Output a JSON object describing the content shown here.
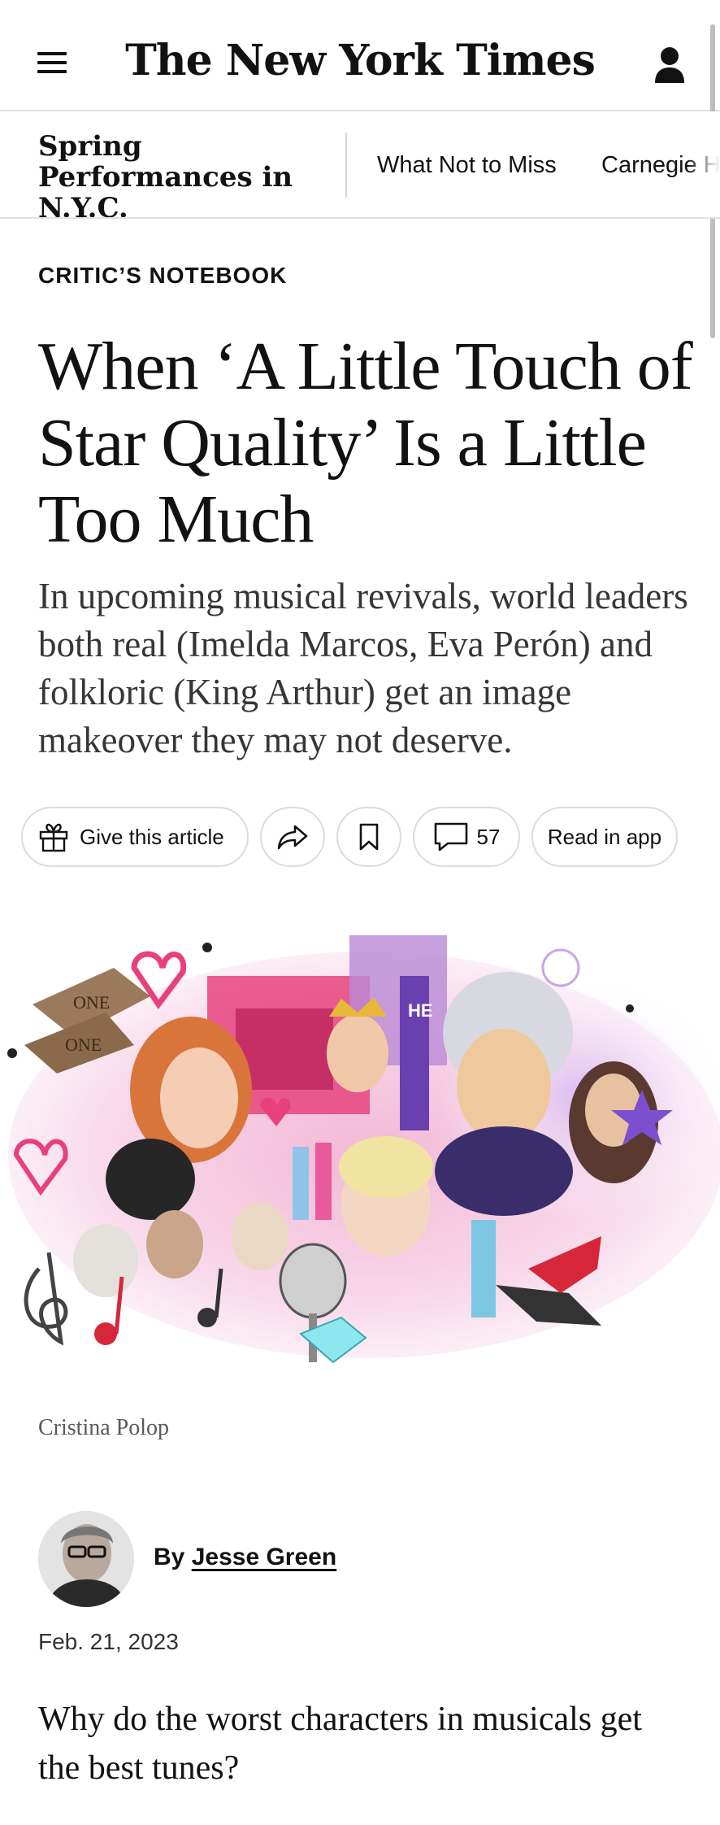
{
  "header": {
    "masthead": "The New York Times",
    "menu_icon": "hamburger-menu-icon",
    "account_icon": "user-account-icon"
  },
  "subnav": {
    "section_title": "Spring Performances in N.Y.C.",
    "links": [
      "What Not to Miss",
      "Carnegie H"
    ]
  },
  "article": {
    "kicker": "CRITIC’S NOTEBOOK",
    "headline": "When ‘A Little Touch of Star Quality’ Is a Little Too Much",
    "summary": "In upcoming musical revivals, world leaders both real (Imelda Marcos, Eva Perón) and folkloric (King Arthur) get an image makeover they may not deserve.",
    "caption": "Cristina Polop",
    "byline_prefix": "By",
    "author": "Jesse Green",
    "date": "Feb. 21, 2023",
    "lede": "Why do the worst characters in musicals get the best tunes?"
  },
  "actions": {
    "gift_label": "Give this article",
    "comments_count": "57",
    "read_in_app_label": "Read in app",
    "icons": [
      "gift-icon",
      "share-icon",
      "bookmark-icon",
      "comment-icon"
    ]
  },
  "illustration": {
    "signs": [
      "ONE",
      "ONE",
      "HE"
    ]
  },
  "colors": {
    "text": "#121212",
    "divider": "#e2e2e2",
    "accent_pink": "#e8407a"
  }
}
